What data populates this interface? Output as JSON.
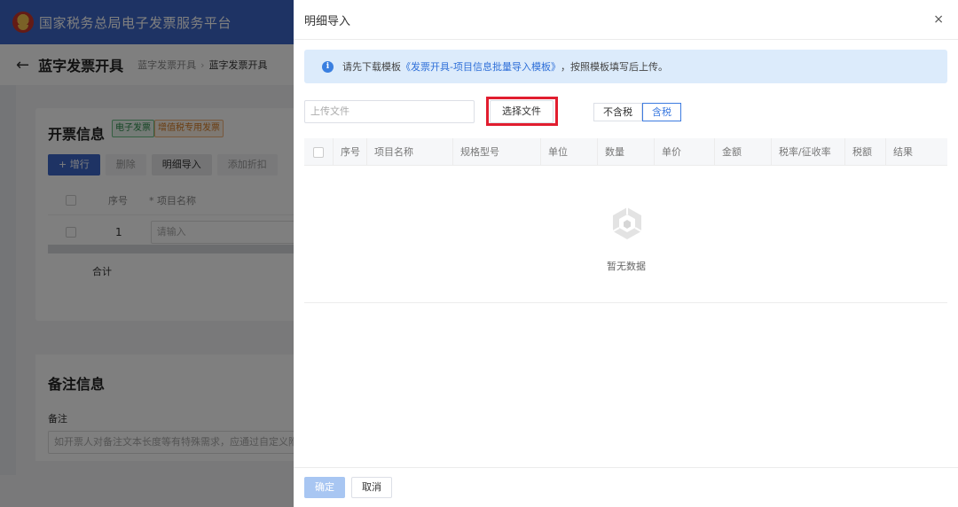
{
  "app": {
    "brand": "国家税务总局电子发票服务平台"
  },
  "page": {
    "title": "蓝字发票开具",
    "breadcrumb": [
      "蓝字发票开具",
      "蓝字发票开具"
    ]
  },
  "invoice_card": {
    "title": "开票信息",
    "tags": [
      "电子发票",
      "增值税专用发票"
    ],
    "buttons": [
      "+ 增行",
      "删除",
      "明细导入",
      "添加折扣"
    ],
    "table_headers": [
      "序号",
      "* 项目名称"
    ],
    "row_index": "1",
    "row_placeholder": "请输入",
    "total_label": "合计"
  },
  "remark_card": {
    "title": "备注信息",
    "field_label": "备注",
    "placeholder": "如开票人对备注文本长度等有特殊需求，应通过自定义附加"
  },
  "drawer": {
    "title": "明细导入",
    "close_label": "×",
    "info": {
      "prefix": "请先下载模板",
      "link": "《发票开具-项目信息批量导入模板》",
      "suffix": "，按照模板填写后上传。"
    },
    "upload_placeholder": "上传文件",
    "select_file_label": "选择文件",
    "tax_options": [
      "不含税",
      "含税"
    ],
    "tax_selected": "含税",
    "columns": [
      "序号",
      "项目名称",
      "规格型号",
      "单位",
      "数量",
      "单价",
      "金额",
      "税率/征收率",
      "税额",
      "结果"
    ],
    "empty_text": "暂无数据",
    "ok_label": "确定",
    "cancel_label": "取消"
  },
  "colors": {
    "topbar": "#3d66c8",
    "info_bg": "#dcebfb",
    "highlight": "#e11d2f",
    "accent": "#3d7be0"
  }
}
